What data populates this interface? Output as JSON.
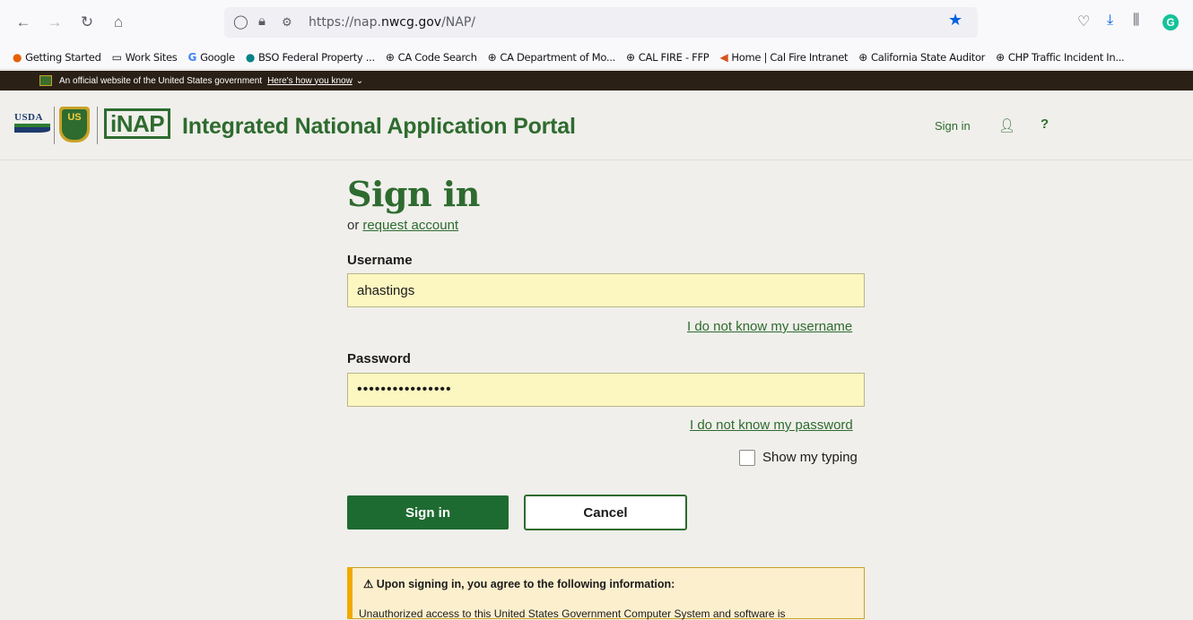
{
  "browser": {
    "url_prefix": "https://nap.",
    "url_domain": "nwcg.gov",
    "url_path": "/NAP/",
    "grammarly": "G"
  },
  "bookmarks": [
    {
      "label": "Getting Started",
      "icon": "firefox-icon"
    },
    {
      "label": "Work Sites",
      "icon": "folder-icon"
    },
    {
      "label": "Google",
      "icon": "google-icon"
    },
    {
      "label": "BSO Federal Property ...",
      "icon": "sharepoint-icon"
    },
    {
      "label": "CA Code Search",
      "icon": "globe-icon"
    },
    {
      "label": "CA Department of Mo...",
      "icon": "globe-icon"
    },
    {
      "label": "CAL FIRE - FFP",
      "icon": "globe-icon"
    },
    {
      "label": "Home | Cal Fire Intranet",
      "icon": "calfire-icon"
    },
    {
      "label": "California State Auditor",
      "icon": "globe-icon"
    },
    {
      "label": "CHP Traffic Incident In...",
      "icon": "globe-icon"
    }
  ],
  "gov_banner": {
    "text": "An official website of the United States government",
    "link": "Here's how you know"
  },
  "header": {
    "usda": "USDA",
    "shield": "US",
    "logo_i": "i",
    "logo_nap": "NAP",
    "title": "Integrated National Application Portal",
    "signin": "Sign in",
    "help": "?"
  },
  "form": {
    "title": "Sign in",
    "or_text": "or",
    "request_account": "request account",
    "username_label": "Username",
    "username_value": "ahastings",
    "forgot_username": "I do not know my username",
    "password_label": "Password",
    "password_value": "••••••••••••••••",
    "forgot_password": "I do not know my password",
    "show_typing": "Show my typing",
    "signin_button": "Sign in",
    "cancel_button": "Cancel"
  },
  "notice": {
    "title": "Upon signing in, you agree to the following information:",
    "body": "Unauthorized access to this United States Government Computer System and software is"
  },
  "colors": {
    "brand_green": "#2e6b2f",
    "button_green": "#1e6b31",
    "field_yellow": "#fcf6c0",
    "notice_bg": "#fbefcd"
  }
}
